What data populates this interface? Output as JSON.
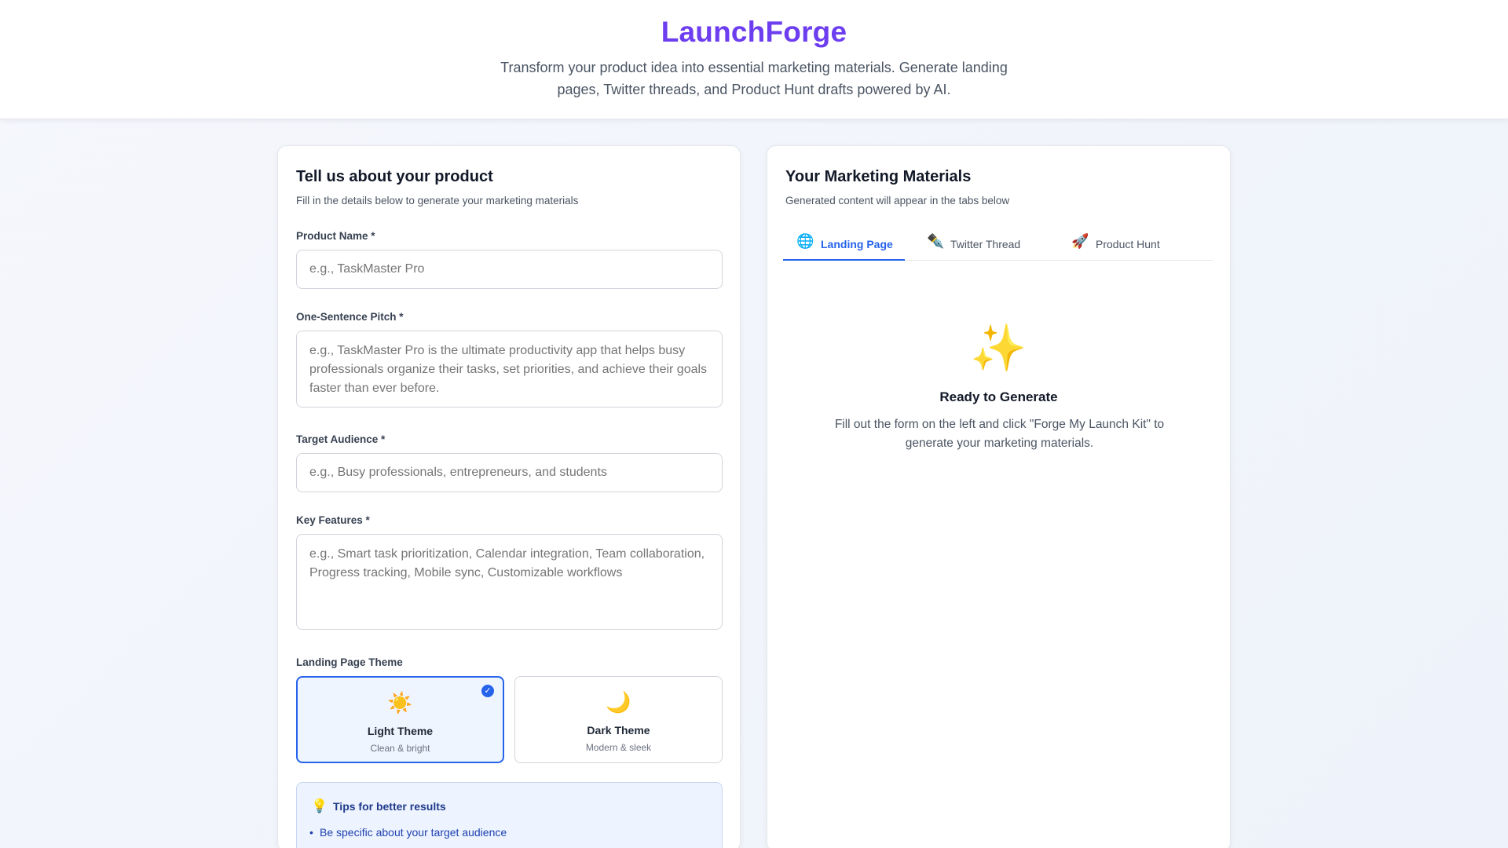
{
  "header": {
    "brand": "LaunchForge",
    "tagline": "Transform your product idea into essential marketing materials. Generate landing pages, Twitter threads, and Product Hunt drafts powered by AI."
  },
  "form": {
    "title": "Tell us about your product",
    "subtitle": "Fill in the details below to generate your marketing materials",
    "product_name": {
      "label": "Product Name *",
      "placeholder": "e.g., TaskMaster Pro",
      "value": ""
    },
    "pitch": {
      "label": "One-Sentence Pitch *",
      "placeholder": "e.g., TaskMaster Pro is the ultimate productivity app that helps busy professionals organize their tasks, set priorities, and achieve their goals faster than ever before.",
      "value": ""
    },
    "audience": {
      "label": "Target Audience *",
      "placeholder": "e.g., Busy professionals, entrepreneurs, and students",
      "value": ""
    },
    "features": {
      "label": "Key Features *",
      "placeholder": "e.g., Smart task prioritization, Calendar integration, Team collaboration, Progress tracking, Mobile sync, Customizable workflows",
      "value": ""
    },
    "theme": {
      "label": "Landing Page Theme",
      "options": [
        {
          "icon": "sun-icon",
          "emoji": "☀️",
          "name": "Light Theme",
          "desc": "Clean & bright",
          "selected": true
        },
        {
          "icon": "moon-icon",
          "emoji": "🌙",
          "name": "Dark Theme",
          "desc": "Modern & sleek",
          "selected": false
        }
      ]
    },
    "tips": {
      "icon": "lightbulb-icon",
      "title": "Tips for better results",
      "items": [
        "Be specific about your target audience"
      ]
    }
  },
  "output": {
    "title": "Your Marketing Materials",
    "subtitle": "Generated content will appear in the tabs below",
    "tabs": [
      {
        "icon": "globe-icon",
        "emoji": "🌐",
        "label": "Landing Page",
        "active": true
      },
      {
        "icon": "pen-icon",
        "emoji": "✒️",
        "label": "Twitter Thread",
        "active": false
      },
      {
        "icon": "rocket-icon",
        "emoji": "🚀",
        "label": "Product Hunt",
        "active": false
      }
    ],
    "empty_state": {
      "icon": "sparkles-icon",
      "title": "Ready to Generate",
      "description": "Fill out the form on the left and click \"Forge My Launch Kit\" to generate your marketing materials."
    }
  },
  "colors": {
    "brand": "#6d3df0",
    "accent": "#2563eb"
  }
}
